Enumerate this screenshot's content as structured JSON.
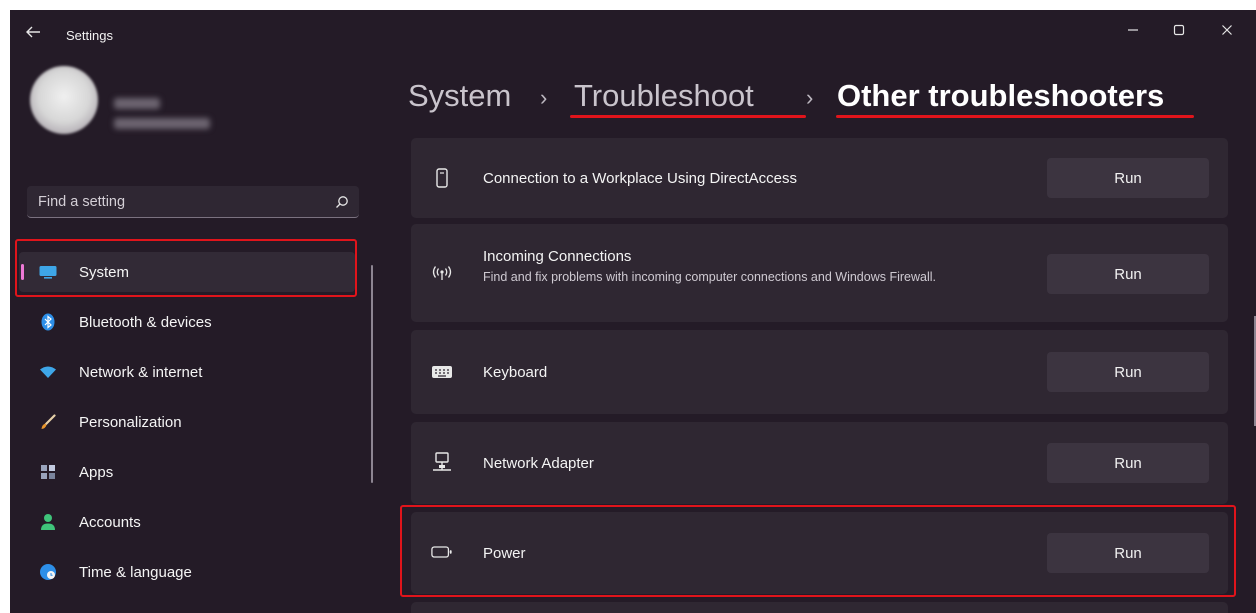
{
  "window": {
    "title": "Settings",
    "back_icon": "back-arrow-icon",
    "controls": [
      "minimize-icon",
      "maximize-icon",
      "close-icon"
    ]
  },
  "search": {
    "placeholder": "Find a setting",
    "icon": "search-icon"
  },
  "sidebar": {
    "items": [
      {
        "label": "System",
        "icon": "monitor-icon",
        "selected": true
      },
      {
        "label": "Bluetooth & devices",
        "icon": "bluetooth-icon"
      },
      {
        "label": "Network & internet",
        "icon": "wifi-icon"
      },
      {
        "label": "Personalization",
        "icon": "brush-icon"
      },
      {
        "label": "Apps",
        "icon": "apps-icon"
      },
      {
        "label": "Accounts",
        "icon": "person-icon"
      },
      {
        "label": "Time & language",
        "icon": "globe-clock-icon"
      }
    ]
  },
  "breadcrumb": {
    "items": [
      "System",
      "Troubleshoot",
      "Other troubleshooters"
    ],
    "separator": "›"
  },
  "troubleshooters": [
    {
      "title": "Connection to a Workplace Using DirectAccess",
      "description": "",
      "icon": "phone-device-icon",
      "button": "Run"
    },
    {
      "title": "Incoming Connections",
      "description": "Find and fix problems with incoming computer connections and Windows Firewall.",
      "icon": "broadcast-icon",
      "button": "Run"
    },
    {
      "title": "Keyboard",
      "description": "",
      "icon": "keyboard-icon",
      "button": "Run"
    },
    {
      "title": "Network Adapter",
      "description": "",
      "icon": "network-adapter-icon",
      "button": "Run"
    },
    {
      "title": "Power",
      "description": "",
      "icon": "battery-icon",
      "button": "Run"
    }
  ],
  "colors": {
    "window_bg": "#241b27",
    "card_bg": "#2f2732",
    "button_bg": "#3c3440",
    "accent": "#ee79d6",
    "highlight": "#e0141b"
  }
}
